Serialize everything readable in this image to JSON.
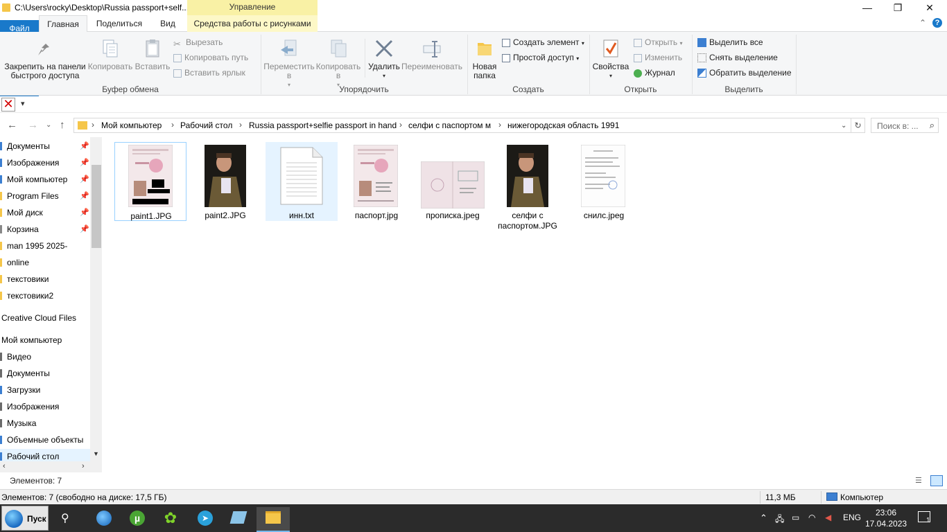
{
  "window": {
    "title": "C:\\Users\\rocky\\Desktop\\Russia passport+self...",
    "context_tab_header": "Управление",
    "buttons": {
      "minimize": "—",
      "maximize": "❐",
      "close": "✕"
    }
  },
  "ribbon_tabs": [
    {
      "label": "Файл"
    },
    {
      "label": "Главная"
    },
    {
      "label": "Поделиться"
    },
    {
      "label": "Вид"
    },
    {
      "label": "Средства работы с рисунками"
    }
  ],
  "ribbon": {
    "clipboard": {
      "label": "Буфер обмена",
      "pin": "Закрепить на панели быстрого доступа",
      "copy": "Копировать",
      "paste": "Вставить",
      "cut": "Вырезать",
      "copy_path": "Копировать путь",
      "paste_shortcut": "Вставить ярлык"
    },
    "organize": {
      "label": "Упорядочить",
      "move_to": "Переместить в",
      "copy_to": "Копировать в",
      "delete": "Удалить",
      "rename": "Переименовать"
    },
    "create": {
      "label": "Создать",
      "new_folder": "Новая папка",
      "new_item": "Создать элемент",
      "easy_access": "Простой доступ"
    },
    "open": {
      "label": "Открыть",
      "properties": "Свойства",
      "open": "Открыть",
      "edit": "Изменить",
      "history": "Журнал"
    },
    "select": {
      "label": "Выделить",
      "select_all": "Выделить все",
      "select_none": "Снять выделение",
      "invert": "Обратить выделение"
    }
  },
  "address": {
    "crumbs": [
      "Мой компьютер",
      "Рабочий стол",
      "Russia passport+selfie passport in hand",
      "селфи с паспортом м",
      "нижегородская область 1991"
    ],
    "search_placeholder": "Поиск в: ..."
  },
  "nav": {
    "items": [
      {
        "label": "Документы",
        "pinned": true,
        "color": "#3c7fd1"
      },
      {
        "label": "Изображения",
        "pinned": true,
        "color": "#3c7fd1"
      },
      {
        "label": "Мой компьютер",
        "pinned": true,
        "color": "#3c7fd1"
      },
      {
        "label": "Program Files",
        "pinned": true,
        "color": "#f5c64a"
      },
      {
        "label": "Мой диск",
        "pinned": true,
        "color": "#f5c64a"
      },
      {
        "label": "Корзина",
        "pinned": true,
        "color": "#888888"
      },
      {
        "label": "man 1995 2025-",
        "pinned": false,
        "color": "#f5c64a"
      },
      {
        "label": "online",
        "pinned": false,
        "color": "#f5c64a"
      },
      {
        "label": "текстовики",
        "pinned": false,
        "color": "#f5c64a"
      },
      {
        "label": "текстовики2",
        "pinned": false,
        "color": "#f5c64a"
      }
    ],
    "creative_cloud": "Creative Cloud Files",
    "my_computer": "Мой компьютер",
    "computer_items": [
      {
        "label": "Видео",
        "color": "#6b6b6b"
      },
      {
        "label": "Документы",
        "color": "#6b6b6b"
      },
      {
        "label": "Загрузки",
        "color": "#3c7fd1"
      },
      {
        "label": "Изображения",
        "color": "#6b6b6b"
      },
      {
        "label": "Музыка",
        "color": "#6b6b6b"
      },
      {
        "label": "Объемные объекты",
        "color": "#3c7fd1"
      },
      {
        "label": "Рабочий стол",
        "color": "#3c7fd1"
      }
    ]
  },
  "files": [
    {
      "name": "paint1.JPG",
      "kind": "passport-redacted"
    },
    {
      "name": "paint2.JPG",
      "kind": "selfie"
    },
    {
      "name": "инн.txt",
      "kind": "text"
    },
    {
      "name": "паспорт.jpg",
      "kind": "passport"
    },
    {
      "name": "прописка.jpeg",
      "kind": "registration"
    },
    {
      "name": "селфи с паспортом.JPG",
      "kind": "selfie"
    },
    {
      "name": "снилс.jpeg",
      "kind": "document"
    }
  ],
  "status": {
    "items_count": "Элементов: 7",
    "detail": "Элементов: 7 (свободно на диске: 17,5 ГБ)",
    "size": "11,3 МБ",
    "location": "Компьютер"
  },
  "taskbar": {
    "start": "Пуск",
    "lang": "ENG",
    "time": "23:06",
    "date": "17.04.2023",
    "notifications": "1"
  }
}
